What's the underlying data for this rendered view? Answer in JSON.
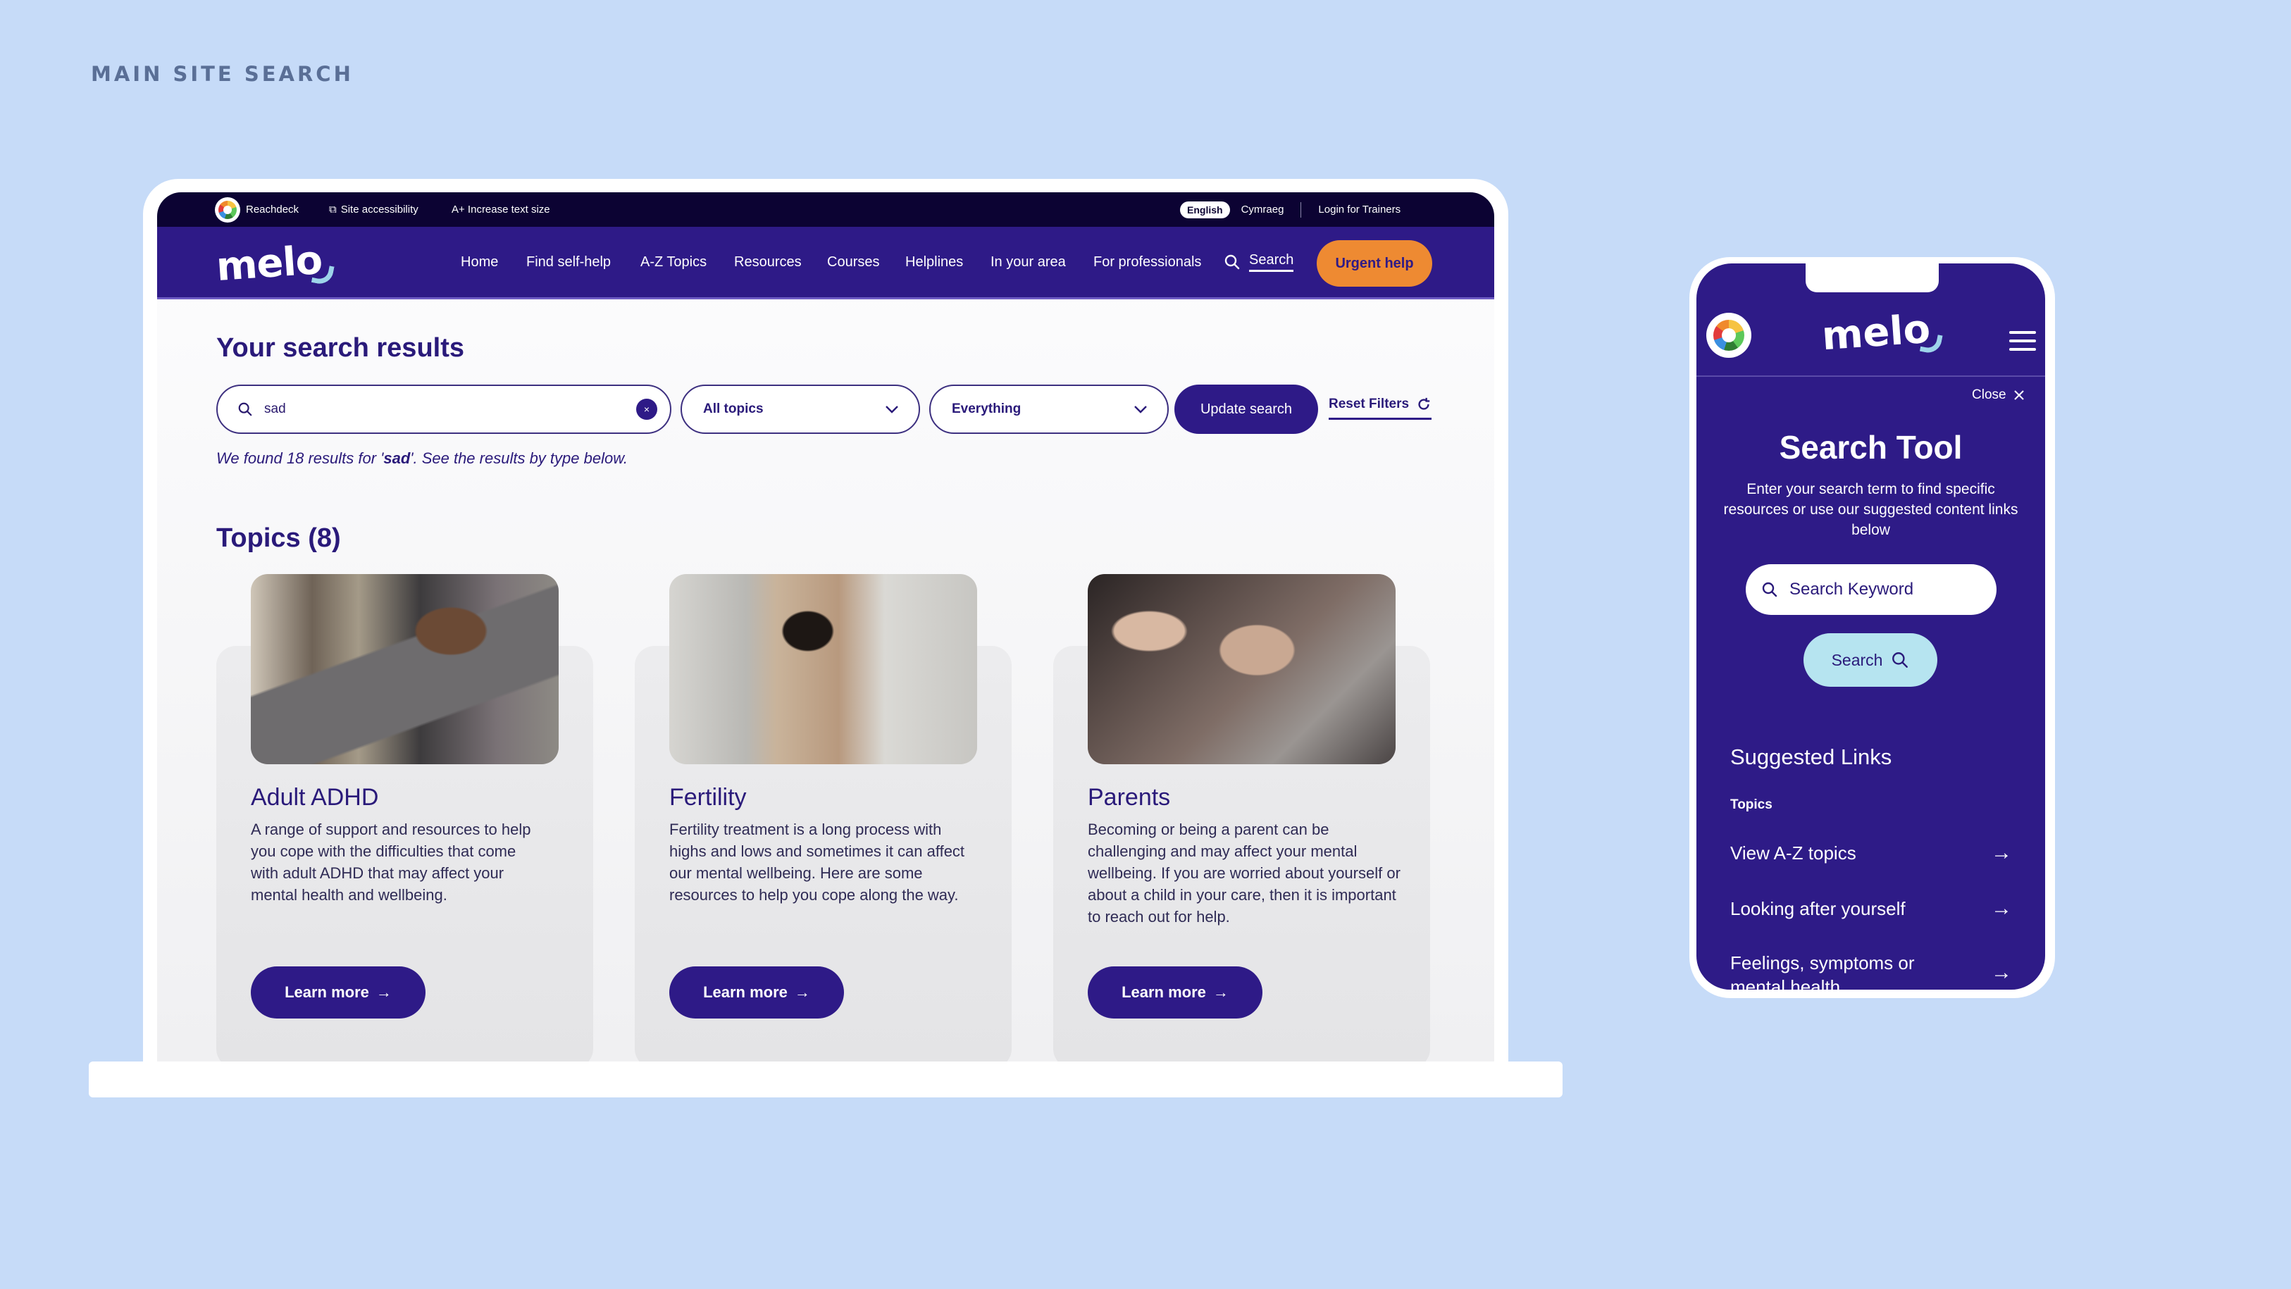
{
  "slide": {
    "title": "MAIN SITE SEARCH"
  },
  "desktop": {
    "topbar": {
      "brand": "Reachdeck",
      "accessibility": "Site accessibility",
      "text_size": "A+ Increase text size",
      "lang_active": "English",
      "lang_other": "Cymraeg",
      "login": "Login for Trainers"
    },
    "nav": {
      "logo": "melo",
      "links": [
        "Home",
        "Find self-help",
        "A-Z Topics",
        "Resources",
        "Courses",
        "Helplines",
        "In your area",
        "For professionals"
      ],
      "search": "Search",
      "urgent": "Urgent help"
    },
    "results": {
      "title": "Your search results",
      "search_value": "sad",
      "clear_icon": "×",
      "topic_filter": "All topics",
      "type_filter": "Everything",
      "update_button": "Update search",
      "reset_link": "Reset Filters",
      "summary_prefix": "We found 18 results for '",
      "summary_term": "sad",
      "summary_suffix": "'. See the results by type below."
    },
    "topics": {
      "heading": "Topics (8)",
      "cards": [
        {
          "title": "Adult ADHD",
          "description": "A range of support and resources to help you cope with the difficulties that come with adult ADHD that may affect your mental health and wellbeing.",
          "button": "Learn more",
          "image": "woman-at-laptop-stressed"
        },
        {
          "title": "Fertility",
          "description": "Fertility treatment is a long process with highs and lows and sometimes it can affect our mental wellbeing. Here are some resources to help you cope along the way.",
          "button": "Learn more",
          "image": "woman-looking-at-test"
        },
        {
          "title": "Parents",
          "description": "Becoming or being a parent can be challenging and may affect your mental wellbeing. If you are worried about yourself or about a child in your care, then it is important to reach out for help.",
          "button": "Learn more",
          "image": "parent-holding-child-hand"
        }
      ]
    }
  },
  "mobile": {
    "logo": "melo",
    "close": "Close",
    "title": "Search Tool",
    "subtitle": "Enter your search term to find specific resources or use our suggested content links below",
    "search_placeholder": "Search Keyword",
    "search_button": "Search",
    "suggested_heading": "Suggested Links",
    "topics_label": "Topics",
    "links": [
      "View A-Z topics",
      "Looking after yourself",
      "Feelings, symptoms or mental health"
    ]
  },
  "colors": {
    "background": "#c6dbf8",
    "brand_purple": "#2e1a87",
    "topbar_dark": "#0c0333",
    "urgent_orange": "#ee8a32",
    "mobile_search_button": "#b6e4f0"
  }
}
